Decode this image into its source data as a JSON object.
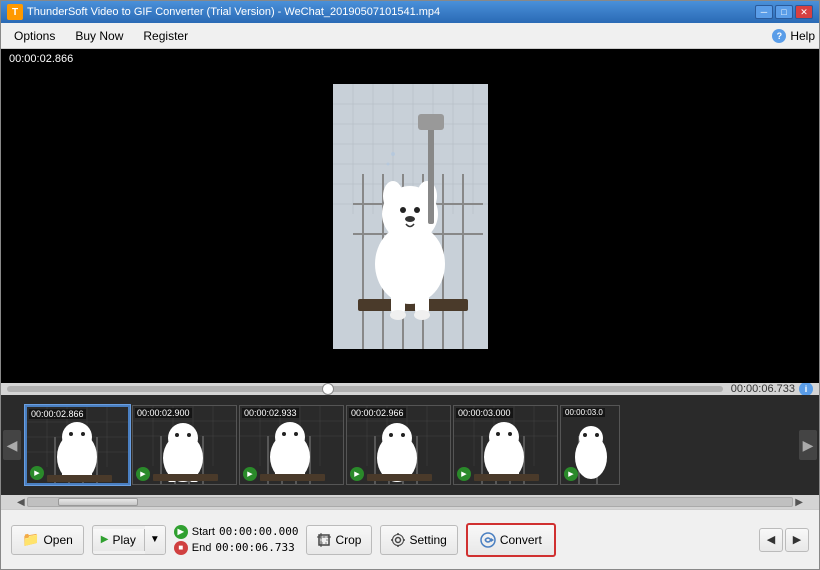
{
  "window": {
    "title": "ThunderSoft Video to GIF Converter (Trial Version) - WeChat_20190507101541.mp4",
    "icon_color": "#ff9900"
  },
  "titlebar": {
    "minimize": "─",
    "maximize": "□",
    "close": "✕"
  },
  "menu": {
    "options": "Options",
    "buy_now": "Buy Now",
    "register": "Register",
    "help_icon": "?",
    "help": "Help"
  },
  "video": {
    "timestamp": "00:00:02.866",
    "duration": "00:00:06.733"
  },
  "filmstrip": {
    "frames": [
      {
        "time": "00:00:02.866",
        "selected": true
      },
      {
        "time": "00:00:02.900",
        "selected": false
      },
      {
        "time": "00:00:02.933",
        "selected": false
      },
      {
        "time": "00:00:02.966",
        "selected": false
      },
      {
        "time": "00:00:03.000",
        "selected": false
      },
      {
        "time": "00:00:03.0",
        "selected": false
      }
    ]
  },
  "toolbar": {
    "open": "Open",
    "play": "Play",
    "start_label": "Start",
    "start_time": "00:00:00.000",
    "end_label": "End",
    "end_time": "00:00:06.733",
    "crop": "Crop",
    "setting": "Setting",
    "convert": "Convert"
  }
}
